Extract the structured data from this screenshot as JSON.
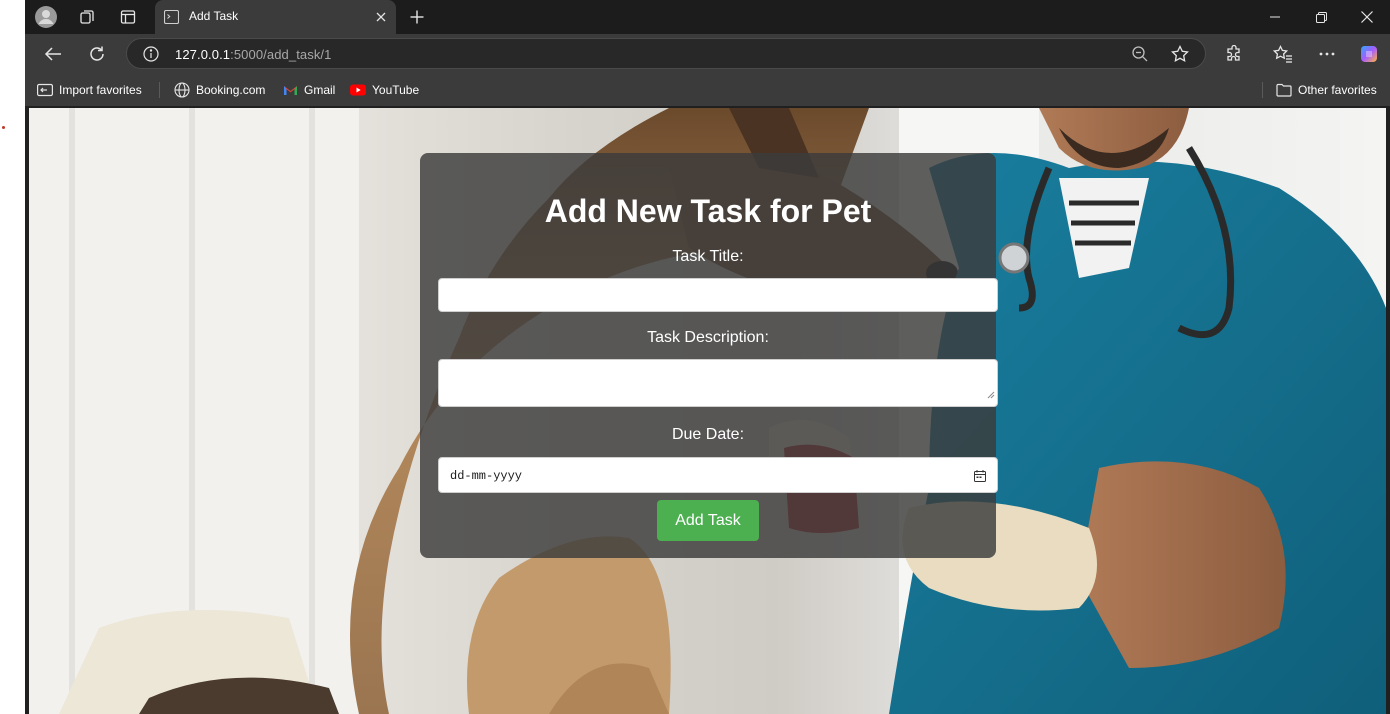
{
  "tab": {
    "title": "Add Task"
  },
  "address": {
    "host": "127.0.0.1",
    "path": ":5000/add_task/1"
  },
  "favorites": {
    "import_label": "Import favorites",
    "booking_label": "Booking.com",
    "gmail_label": "Gmail",
    "youtube_label": "YouTube",
    "other_label": "Other favorites"
  },
  "form": {
    "heading": "Add New Task for Pet",
    "title_label": "Task Title:",
    "title_value": "",
    "description_label": "Task Description:",
    "description_value": "",
    "due_label": "Due Date:",
    "due_placeholder": "dd-mm-yyyy",
    "submit_label": "Add Task"
  },
  "colors": {
    "submit_button": "#4caf50",
    "card_background": "rgba(60,60,60,0.82)",
    "browser_chrome": "#3b3b3b"
  },
  "icons": {
    "profile": "profile-avatar-icon",
    "collections": "collections-icon",
    "tab_actions": "tab-actions-icon",
    "back": "back-arrow-icon",
    "refresh": "refresh-icon",
    "site_info": "info-icon",
    "zoom": "zoom-out-icon",
    "favorite": "star-icon",
    "extensions": "extensions-icon",
    "favorites_hub": "favorites-icon",
    "more": "more-icon",
    "copilot": "copilot-icon",
    "calendar": "calendar-icon"
  }
}
